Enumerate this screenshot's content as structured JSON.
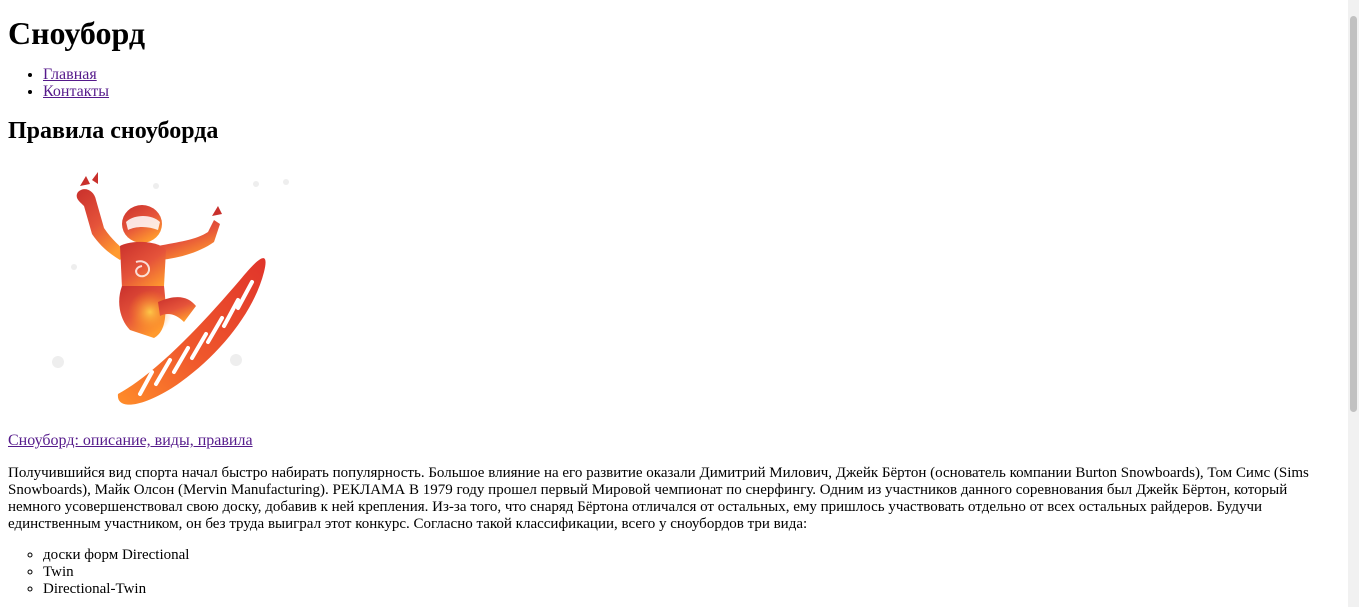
{
  "header": {
    "site_title": "Сноуборд"
  },
  "nav": {
    "items": [
      {
        "label": "Главная"
      },
      {
        "label": "Контакты"
      }
    ]
  },
  "main": {
    "heading": "Правила сноуборда",
    "image": {
      "icon": "snowboarder-illustration"
    },
    "caption_link": "Сноуборд: описание, виды, правила",
    "article_text": "Получившийся вид спорта начал быстро набирать популярность. Большое влияние на его развитие оказали Димитрий Милович, Джейк Бёртон (основатель компании Burton Snowboards), Том Симс (Sims Snowboards), Майк Олсон (Mervin Manufacturing). РЕКЛАМА В 1979 году прошел первый Мировой чемпионат по снерфингу. Одним из участников данного соревнования был Джейк Бёртон, который немного усовершенствовал свою доску, добавив к ней крепления. Из-за того, что снаряд Бёртона отличался от остальных, ему пришлось участвовать отдельно от всех остальных райдеров. Будучи единственным участником, он без труда выиграл этот конкурс. Согласно такой классификации, всего у сноубордов три вида:",
    "types": [
      {
        "label": "доски форм Directional"
      },
      {
        "label": "Twin"
      },
      {
        "label": "Directional-Twin"
      }
    ]
  },
  "colors": {
    "link_visited": "#551a8b",
    "board_red": "#e53a2f",
    "board_orange": "#ff8c1a",
    "scrollbar_track": "#f1f1f1",
    "scrollbar_thumb": "#c1c1c1"
  }
}
